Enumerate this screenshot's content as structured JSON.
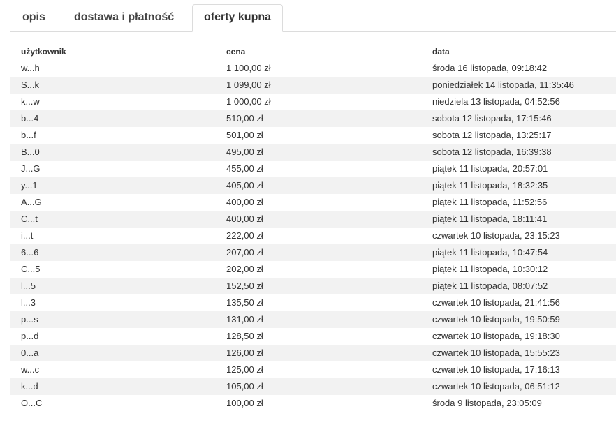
{
  "tabs": [
    {
      "label": "opis",
      "active": false
    },
    {
      "label": "dostawa i płatność",
      "active": false
    },
    {
      "label": "oferty kupna",
      "active": true
    }
  ],
  "table": {
    "headers": [
      "użytkownik",
      "cena",
      "data"
    ],
    "rows": [
      {
        "user": "w...h",
        "price": "1 100,00 zł",
        "date": "środa 16 listopada, 09:18:42"
      },
      {
        "user": "S...k",
        "price": "1 099,00 zł",
        "date": "poniedziałek 14 listopada, 11:35:46"
      },
      {
        "user": "k...w",
        "price": "1 000,00 zł",
        "date": "niedziela 13 listopada, 04:52:56"
      },
      {
        "user": "b...4",
        "price": "510,00 zł",
        "date": "sobota 12 listopada, 17:15:46"
      },
      {
        "user": "b...f",
        "price": "501,00 zł",
        "date": "sobota 12 listopada, 13:25:17"
      },
      {
        "user": "B...0",
        "price": "495,00 zł",
        "date": "sobota 12 listopada, 16:39:38"
      },
      {
        "user": "J...G",
        "price": "455,00 zł",
        "date": "piątek 11 listopada, 20:57:01"
      },
      {
        "user": "y...1",
        "price": "405,00 zł",
        "date": "piątek 11 listopada, 18:32:35"
      },
      {
        "user": "A...G",
        "price": "400,00 zł",
        "date": "piątek 11 listopada, 11:52:56"
      },
      {
        "user": "C...t",
        "price": "400,00 zł",
        "date": "piątek 11 listopada, 18:11:41"
      },
      {
        "user": "i...t",
        "price": "222,00 zł",
        "date": "czwartek 10 listopada, 23:15:23"
      },
      {
        "user": "6...6",
        "price": "207,00 zł",
        "date": "piątek 11 listopada, 10:47:54"
      },
      {
        "user": "C...5",
        "price": "202,00 zł",
        "date": "piątek 11 listopada, 10:30:12"
      },
      {
        "user": "l...5",
        "price": "152,50 zł",
        "date": "piątek 11 listopada, 08:07:52"
      },
      {
        "user": "l...3",
        "price": "135,50 zł",
        "date": "czwartek 10 listopada, 21:41:56"
      },
      {
        "user": "p...s",
        "price": "131,00 zł",
        "date": "czwartek 10 listopada, 19:50:59"
      },
      {
        "user": "p...d",
        "price": "128,50 zł",
        "date": "czwartek 10 listopada, 19:18:30"
      },
      {
        "user": "0...a",
        "price": "126,00 zł",
        "date": "czwartek 10 listopada, 15:55:23"
      },
      {
        "user": "w...c",
        "price": "125,00 zł",
        "date": "czwartek 10 listopada, 17:16:13"
      },
      {
        "user": "k...d",
        "price": "105,00 zł",
        "date": "czwartek 10 listopada, 06:51:12"
      },
      {
        "user": "O...C",
        "price": "100,00 zł",
        "date": "środa 9 listopada, 23:05:09"
      }
    ]
  }
}
